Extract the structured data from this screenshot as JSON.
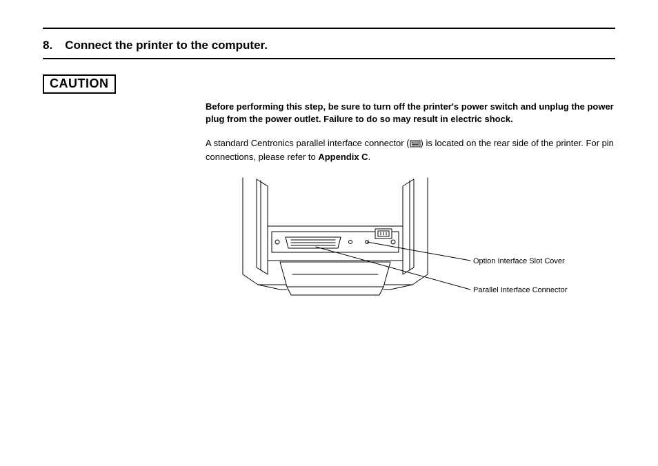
{
  "heading": {
    "number": "8.",
    "title": "Connect the printer to the computer."
  },
  "caution_label": "CAUTION",
  "warning_text": "Before performing this step, be sure to turn off the printer's power switch and unplug the power plug from the power outlet.  Failure to do so may result in electric shock.",
  "paragraph": {
    "pre_icon": "A standard Centronics parallel interface connector (",
    "post_icon": ") is located on the rear side of the printer.  For pin connections, please refer to ",
    "appendix_bold": "Appendix C",
    "after": "."
  },
  "callouts": {
    "option_slot": "Option Interface Slot Cover",
    "parallel_conn": "Parallel Interface Connector"
  }
}
